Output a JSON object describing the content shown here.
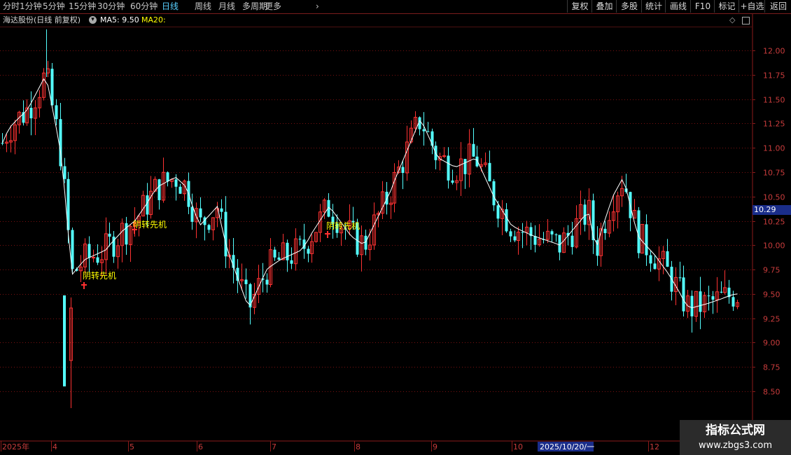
{
  "toolbar": {
    "timeframes": [
      "分时",
      "1分钟",
      "5分钟",
      "15分钟",
      "30分钟",
      "60分钟",
      "日线",
      "周线",
      "月线",
      "多周期",
      "更多"
    ],
    "active": "日线",
    "right_buttons": [
      "复权",
      "叠加",
      "多股",
      "统计",
      "画线",
      "F10",
      "标记",
      "+自选",
      "返回"
    ]
  },
  "info": {
    "stock_title": "海达股份(日线 前复权)",
    "ma5_label": "MA5: 9.50",
    "ma20_label": "MA20:"
  },
  "colors": {
    "up": "#ff3232",
    "down": "#54ffff",
    "ma5": "#ffffff",
    "ma20": "#ffff00",
    "grid": "#8b0000",
    "signal": "#ffff00"
  },
  "price_badge": "10.29",
  "signal_text": "阴转先机",
  "x_axis": {
    "labels": [
      "2025年",
      "4",
      "5",
      "6",
      "7",
      "8",
      "9",
      "10",
      "12"
    ],
    "highlight_label": "2025/10/20/一"
  },
  "watermark": {
    "line1": "指标公式网",
    "line2": "www.zbgs3.com"
  },
  "chart_data": {
    "type": "candlestick",
    "y_ticks": [
      12.0,
      11.75,
      11.5,
      11.25,
      11.0,
      10.75,
      10.5,
      10.25,
      10.0,
      9.75,
      9.5,
      9.25,
      9.0,
      8.75,
      8.5
    ],
    "ylim": [
      8.2,
      12.35
    ],
    "ma5_path_anchor_prices": [
      11.0,
      11.2,
      11.3,
      11.4,
      11.75,
      11.0,
      10.3,
      9.7,
      9.85,
      9.95,
      10.15,
      10.25,
      10.6,
      10.7,
      10.6,
      10.2,
      10.4,
      10.05,
      9.35,
      9.75,
      9.85,
      9.95,
      10.4,
      10.1,
      10.0,
      10.6,
      11.3,
      10.9,
      10.8,
      10.9,
      10.5,
      10.2,
      10.1,
      10.0,
      10.35,
      9.95,
      10.5,
      10.7,
      10.1,
      9.9,
      9.7,
      9.45,
      9.35,
      9.4,
      9.5
    ]
  }
}
